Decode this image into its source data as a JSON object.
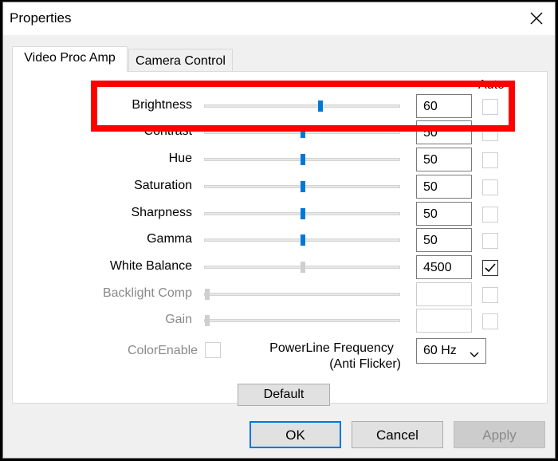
{
  "window": {
    "title": "Properties"
  },
  "tabs": [
    {
      "label": "Video Proc Amp",
      "active": true
    },
    {
      "label": "Camera Control",
      "active": false
    }
  ],
  "auto_header": "Auto",
  "controls": [
    {
      "label": "Brightness",
      "value": "60",
      "slider_fraction": 0.59,
      "enabled": true,
      "auto": false
    },
    {
      "label": "Contrast",
      "value": "50",
      "slider_fraction": 0.5,
      "enabled": true,
      "auto": false
    },
    {
      "label": "Hue",
      "value": "50",
      "slider_fraction": 0.5,
      "enabled": true,
      "auto": false
    },
    {
      "label": "Saturation",
      "value": "50",
      "slider_fraction": 0.5,
      "enabled": true,
      "auto": false
    },
    {
      "label": "Sharpness",
      "value": "50",
      "slider_fraction": 0.5,
      "enabled": true,
      "auto": false
    },
    {
      "label": "Gamma",
      "value": "50",
      "slider_fraction": 0.5,
      "enabled": true,
      "auto": false
    },
    {
      "label": "White Balance",
      "value": "4500",
      "slider_fraction": 0.5,
      "enabled": true,
      "auto": true
    },
    {
      "label": "Backlight Comp",
      "value": "",
      "slider_fraction": 0.0,
      "enabled": false,
      "auto": false
    },
    {
      "label": "Gain",
      "value": "",
      "slider_fraction": 0.0,
      "enabled": false,
      "auto": false
    }
  ],
  "color_enable": {
    "label": "ColorEnable",
    "checked": false
  },
  "powerline": {
    "label_line1": "PowerLine Frequency",
    "label_line2": "(Anti Flicker)",
    "selected": "60 Hz"
  },
  "buttons": {
    "default": "Default",
    "ok": "OK",
    "cancel": "Cancel",
    "apply": "Apply"
  },
  "colors": {
    "highlight": "#ff0000",
    "accent": "#0078d7"
  }
}
